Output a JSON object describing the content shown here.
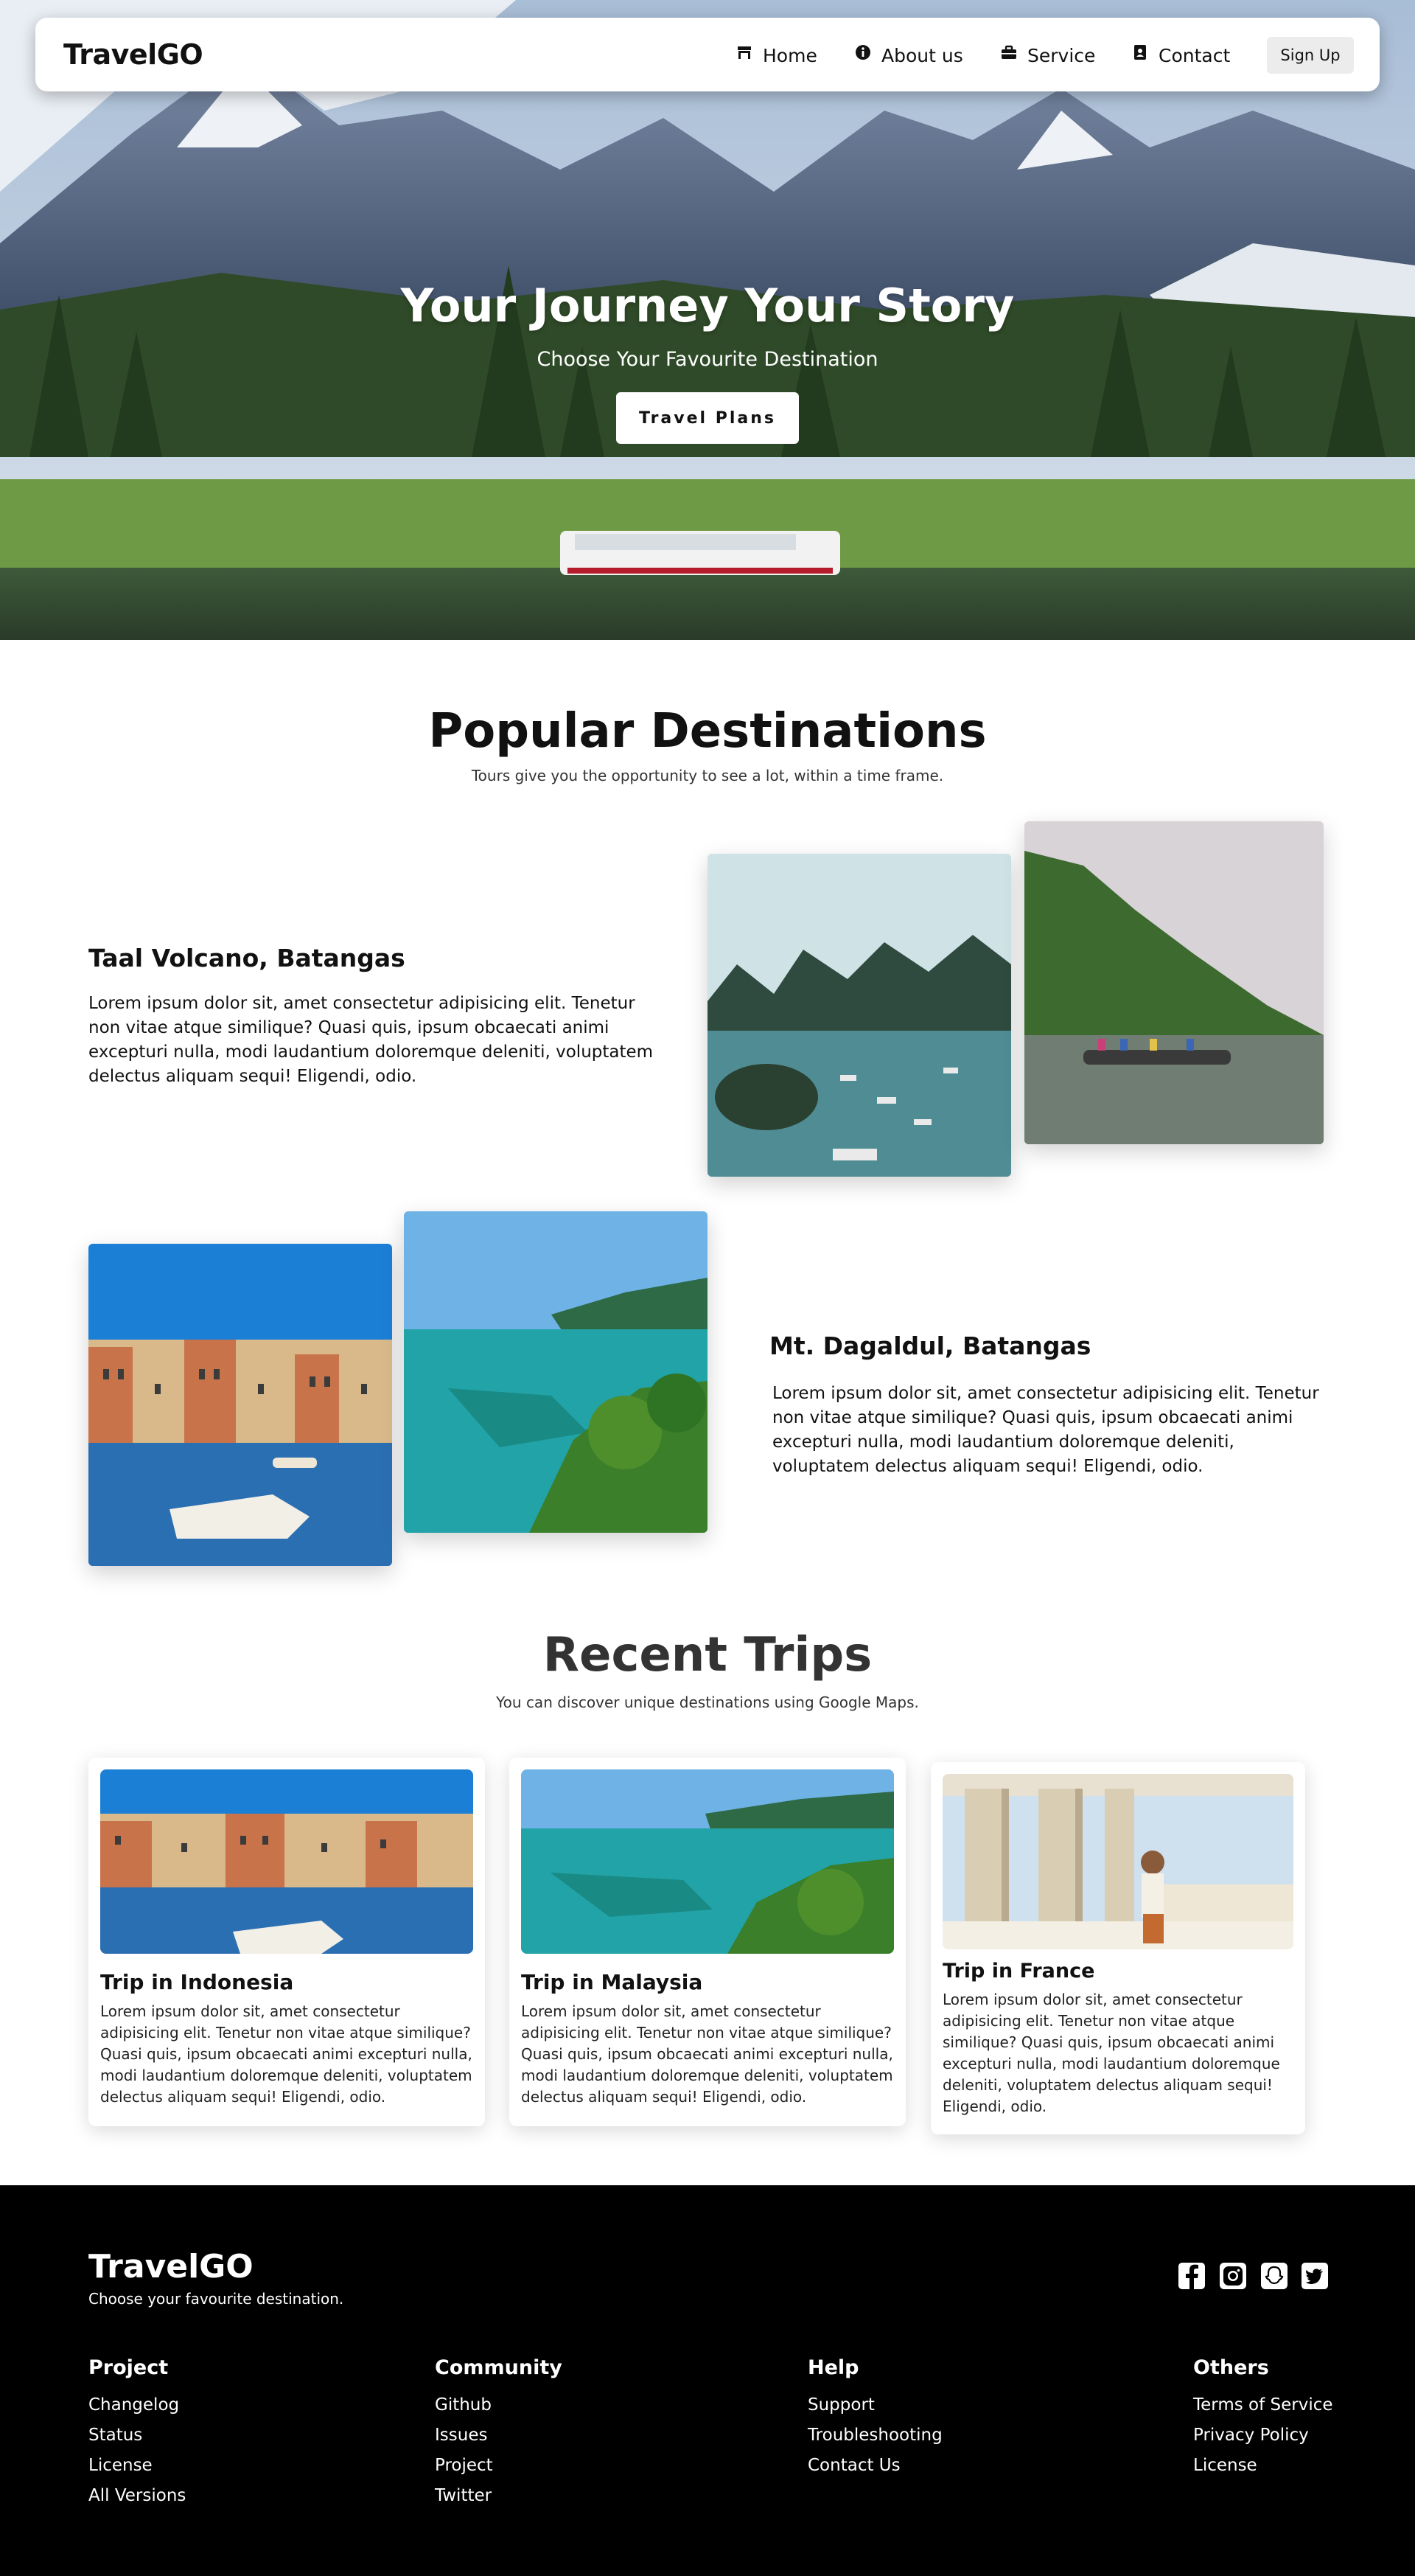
{
  "nav": {
    "brand": "TravelGO",
    "items": [
      {
        "label": "Home",
        "icon": "shop-icon"
      },
      {
        "label": "About us",
        "icon": "info-icon"
      },
      {
        "label": "Service",
        "icon": "briefcase-icon"
      },
      {
        "label": "Contact",
        "icon": "contact-card-icon"
      }
    ],
    "signup": "Sign Up"
  },
  "hero": {
    "title": "Your Journey Your Story",
    "subtitle": "Choose Your Favourite Destination",
    "button": "Travel Plans"
  },
  "popular": {
    "title": "Popular Destinations",
    "subtitle": "Tours give you the opportunity to see a lot, within a time frame.",
    "destinations": [
      {
        "name": "Taal Volcano, Batangas",
        "text": "Lorem ipsum dolor sit, amet consectetur adipisicing elit. Tenetur non vitae atque similique? Quasi quis, ipsum obcaecati animi excepturi nulla, modi laudantium doloremque deleniti, voluptatem delectus aliquam sequi! Eligendi, odio."
      },
      {
        "name": "Mt. Dagaldul, Batangas",
        "text": "Lorem ipsum dolor sit, amet consectetur adipisicing elit. Tenetur non vitae atque similique? Quasi quis, ipsum obcaecati animi excepturi nulla, modi laudantium doloremque deleniti, voluptatem delectus aliquam sequi! Eligendi, odio."
      }
    ]
  },
  "recent": {
    "title": "Recent Trips",
    "subtitle": "You can discover unique destinations using Google Maps.",
    "cards": [
      {
        "title": "Trip in Indonesia",
        "text": "Lorem ipsum dolor sit, amet consectetur adipisicing elit. Tenetur non vitae atque similique? Quasi quis, ipsum obcaecati animi excepturi nulla, modi laudantium doloremque deleniti, voluptatem delectus aliquam sequi! Eligendi, odio."
      },
      {
        "title": "Trip in Malaysia",
        "text": "Lorem ipsum dolor sit, amet consectetur adipisicing elit. Tenetur non vitae atque similique? Quasi quis, ipsum obcaecati animi excepturi nulla, modi laudantium doloremque deleniti, voluptatem delectus aliquam sequi! Eligendi, odio."
      },
      {
        "title": "Trip in France",
        "text": "Lorem ipsum dolor sit, amet consectetur adipisicing elit. Tenetur non vitae atque similique? Quasi quis, ipsum obcaecati animi excepturi nulla, modi laudantium doloremque deleniti, voluptatem delectus aliquam sequi! Eligendi, odio."
      }
    ]
  },
  "footer": {
    "brand": "TravelGO",
    "tagline": "Choose your favourite destination.",
    "social": [
      "facebook-icon",
      "instagram-icon",
      "snapchat-icon",
      "twitter-icon"
    ],
    "columns": [
      {
        "title": "Project",
        "links": [
          "Changelog",
          "Status",
          "License",
          "All Versions"
        ]
      },
      {
        "title": "Community",
        "links": [
          "Github",
          "Issues",
          "Project",
          "Twitter"
        ]
      },
      {
        "title": "Help",
        "links": [
          "Support",
          "Troubleshooting",
          "Contact Us"
        ]
      },
      {
        "title": "Others",
        "links": [
          "Terms of Service",
          "Privacy Policy",
          "License"
        ]
      }
    ]
  }
}
